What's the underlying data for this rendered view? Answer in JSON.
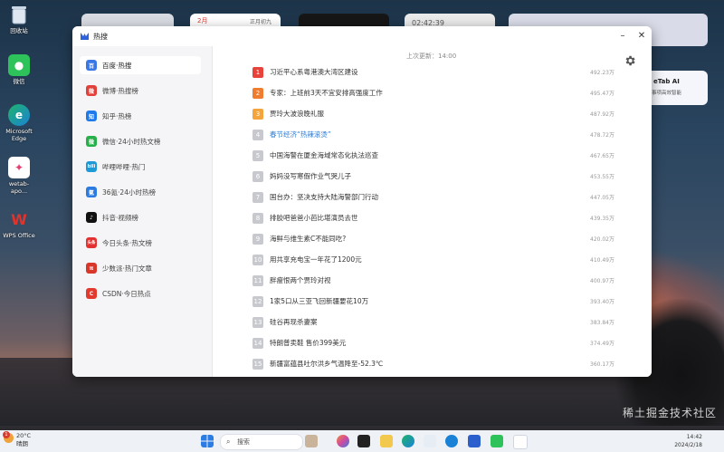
{
  "desktop": {
    "icons": [
      {
        "label": "回收站",
        "icon": "recycle-bin-icon"
      },
      {
        "label": "微信",
        "icon": "wechat-icon"
      },
      {
        "label": "Microsoft Edge",
        "icon": "edge-icon"
      },
      {
        "label": "wetab-apo...",
        "icon": "wetab-icon"
      },
      {
        "label": "WPS Office",
        "icon": "wps-icon"
      }
    ],
    "widgets": {
      "calendar_label": "2月",
      "calendar_sub": "正月初九",
      "clock": "02:42:39"
    },
    "wetab_card": {
      "title": "eTab AI",
      "subtitle": "事项高效智能"
    }
  },
  "window": {
    "title": "热搜",
    "colors": {
      "accent": "#2e7cd6",
      "rank1": "#e8433a",
      "rank2": "#f07c30",
      "rank3": "#f3a43a"
    }
  },
  "sidebar": {
    "items": [
      {
        "label": "百度·热搜",
        "icon": "baidu-icon",
        "color": "#3a78e6",
        "glyph": "百"
      },
      {
        "label": "微博·热搜榜",
        "icon": "weibo-icon",
        "color": "#e2413a",
        "glyph": "微"
      },
      {
        "label": "知乎·热榜",
        "icon": "zhihu-icon",
        "color": "#1f7bea",
        "glyph": "知"
      },
      {
        "label": "微信·24小时热文榜",
        "icon": "wechat-icon",
        "color": "#27b04a",
        "glyph": "微"
      },
      {
        "label": "哔哩哔哩·热门",
        "icon": "bilibili-icon",
        "color": "#1e9ad6",
        "glyph": "bili"
      },
      {
        "label": "36氪·24小时热榜",
        "icon": "36kr-icon",
        "color": "#2c7be0",
        "glyph": "氪"
      },
      {
        "label": "抖音·视频榜",
        "icon": "douyin-icon",
        "color": "#111111",
        "glyph": "♪"
      },
      {
        "label": "今日头条·热文榜",
        "icon": "toutiao-icon",
        "color": "#e3312f",
        "glyph": "头条"
      },
      {
        "label": "少数派·热门文章",
        "icon": "sspai-icon",
        "color": "#d8372a",
        "glyph": "π"
      },
      {
        "label": "CSDN·今日热点",
        "icon": "csdn-icon",
        "color": "#e33a2e",
        "glyph": "C"
      }
    ]
  },
  "main": {
    "updated_label": "上次更新：14:00",
    "rows": [
      {
        "rank": "1",
        "title": "习近平心系粤港澳大湾区建设",
        "hot": "492.23万"
      },
      {
        "rank": "2",
        "title": "专家：上班前3天不宜安排高强度工作",
        "hot": "495.47万"
      },
      {
        "rank": "3",
        "title": "贾玲大波浪晚礼服",
        "hot": "487.92万"
      },
      {
        "rank": "4",
        "title": "春节经济“热辣滚烫”",
        "hot": "478.72万"
      },
      {
        "rank": "5",
        "title": "中国海警在厦金海域常态化执法巡查",
        "hot": "467.65万"
      },
      {
        "rank": "6",
        "title": "妈妈没写寒假作业气哭儿子",
        "hot": "453.55万"
      },
      {
        "rank": "7",
        "title": "国台办：坚决支持大陆海警部门行动",
        "hot": "447.05万"
      },
      {
        "rank": "8",
        "title": "排胶吧爸爸小芭比堪演员去世",
        "hot": "439.35万"
      },
      {
        "rank": "9",
        "title": "海鲜与维生素C不能同吃?",
        "hot": "420.02万"
      },
      {
        "rank": "10",
        "title": "用共享充电宝一年花了1200元",
        "hot": "410.49万"
      },
      {
        "rank": "11",
        "title": "胖瘦恨两个贾玲对视",
        "hot": "400.97万"
      },
      {
        "rank": "12",
        "title": "1家5口从三亚飞回新疆要花10万",
        "hot": "393.40万"
      },
      {
        "rank": "13",
        "title": "硅谷再现杀妻案",
        "hot": "383.84万"
      },
      {
        "rank": "14",
        "title": "特朗普卖鞋 售价399美元",
        "hot": "374.49万"
      },
      {
        "rank": "15",
        "title": "新疆富蕴县吐尔洪乡气温降至-52.3℃",
        "hot": "360.17万"
      }
    ]
  },
  "taskbar": {
    "weather_temp": "20°C",
    "weather_desc": "晴朗",
    "badge": "1",
    "search_placeholder": "搜索",
    "time": "14:42",
    "date": "2024/2/18"
  },
  "watermark": "稀土掘金技术社区"
}
